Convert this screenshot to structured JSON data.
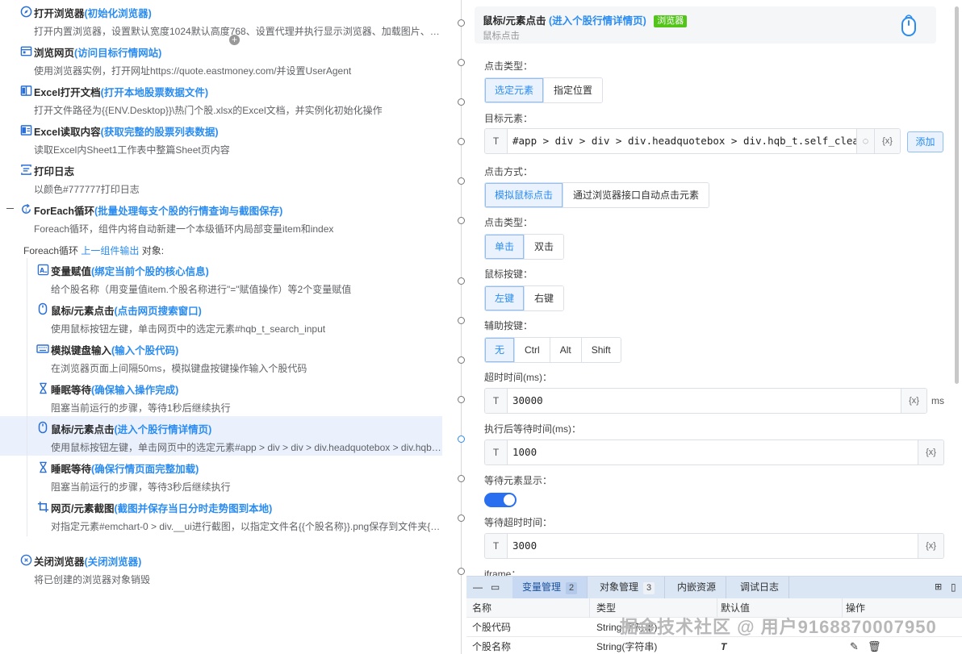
{
  "workflow": {
    "steps": [
      {
        "title": "打开浏览器",
        "note": "(初始化浏览器)",
        "desc": "打开内置浏览器，设置默认宽度1024默认高度768、设置代理并执行显示浏览器、加载图片、…",
        "icon": "compass-icon"
      },
      {
        "title": "浏览网页",
        "note": "(访问目标行情网站)",
        "desc": "使用浏览器实例，打开网址https://quote.eastmoney.com/并设置UserAgent",
        "icon": "browser-window-icon"
      },
      {
        "title": "Excel打开文档",
        "note": "(打开本地股票数据文件)",
        "desc": "打开文件路径为{{ENV.Desktop}}\\热门个股.xlsx的Excel文档，并实例化初始化操作",
        "icon": "excel-book-icon"
      },
      {
        "title": "Excel读取内容",
        "note": "(获取完整的股票列表数据)",
        "desc": "读取Excel内Sheet1工作表中整篇Sheet页内容",
        "icon": "excel-read-icon"
      },
      {
        "title": "打印日志",
        "note": "",
        "desc": "以颜色#777777打印日志",
        "icon": "print-log-icon"
      },
      {
        "title": "ForEach循环",
        "note": "(批量处理每支个股的行情查询与截图保存)",
        "desc": "Foreach循环，组件内将自动新建一个本级循环内局部变量item和index",
        "icon": "loop-icon"
      }
    ],
    "foreach_label": {
      "prefix": "Foreach循环",
      "link": "上一组件输出",
      "suffix": "对象:"
    },
    "children": [
      {
        "title": "变量赋值",
        "note": "(绑定当前个股的核心信息)",
        "desc": "给个股名称（用变量值item.个股名称进行\"=\"赋值操作）等2个变量赋值",
        "icon": "variable-assign-icon"
      },
      {
        "title": "鼠标/元素点击",
        "note": "(点击网页搜索窗口)",
        "desc": "使用鼠标按钮左键，单击网页中的选定元素#hqb_t_search_input",
        "icon": "mouse-icon"
      },
      {
        "title": "模拟键盘输入",
        "note": "(输入个股代码)",
        "desc": "在浏览器页面上间隔50ms，模拟键盘按键操作输入个股代码",
        "icon": "keyboard-icon"
      },
      {
        "title": "睡眠等待",
        "note": "(确保输入操作完成)",
        "desc": "阻塞当前运行的步骤，等待1秒后继续执行",
        "icon": "hourglass-icon"
      },
      {
        "title": "鼠标/元素点击",
        "note": "(进入个股行情详情页)",
        "desc": "使用鼠标按钮左键，单击网页中的选定元素#app > div > div > div.headquotebox > div.hqb…",
        "icon": "mouse-icon"
      },
      {
        "title": "睡眠等待",
        "note": "(确保行情页面完整加载)",
        "desc": "阻塞当前运行的步骤，等待3秒后继续执行",
        "icon": "hourglass-icon"
      },
      {
        "title": "网页/元素截图",
        "note": "(截图并保存当日分时走势图到本地)",
        "desc": "对指定元素#emchart-0 > div.__ui进行截图，以指定文件名{{个股名称}}.png保存到文件夹{{…",
        "icon": "crop-icon"
      }
    ],
    "final_step": {
      "title": "关闭浏览器",
      "note": "(关闭浏览器)",
      "desc": "将已创建的浏览器对象销毁",
      "icon": "close-browser-icon"
    }
  },
  "properties": {
    "header": {
      "title": "鼠标/元素点击",
      "note": "(进入个股行情详情页)",
      "badge": "浏览器",
      "subtitle": "鼠标点击",
      "badge_color": "#52c41a"
    },
    "click_type_label": "点击类型：",
    "click_type_options": [
      "选定元素",
      "指定位置"
    ],
    "target_label": "目标元素：",
    "target_tag": "T",
    "target_value": "#app > div > div > div.headquotebox > div.hqb_t.self_clear",
    "target_var": "{x}",
    "add_label": "添加",
    "method_label": "点击方式：",
    "method_options": [
      "模拟鼠标点击",
      "通过浏览器接口自动点击元素"
    ],
    "click_kind_label": "点击类型：",
    "click_kind_options": [
      "单击",
      "双击"
    ],
    "mouse_button_label": "鼠标按键：",
    "mouse_button_options": [
      "左键",
      "右键"
    ],
    "modifier_label": "辅助按键：",
    "modifier_options": [
      "无",
      "Ctrl",
      "Alt",
      "Shift"
    ],
    "timeout_label": "超时时间(ms)：",
    "timeout_tag": "T",
    "timeout_value": "30000",
    "timeout_var": "{x}",
    "timeout_unit": "ms",
    "after_wait_label": "执行后等待时间(ms)：",
    "after_wait_tag": "T",
    "after_wait_value": "1000",
    "after_wait_var": "{x}",
    "wait_visible_label": "等待元素显示：",
    "wait_visible_on": true,
    "wait_timeout_label": "等待超时时间：",
    "wait_timeout_tag": "T",
    "wait_timeout_value": "3000",
    "wait_timeout_var": "{x}",
    "iframe_label": "iframe："
  },
  "dock": {
    "tabs": [
      {
        "label": "变量管理",
        "count": "2"
      },
      {
        "label": "对象管理",
        "count": "3"
      },
      {
        "label": "内嵌资源",
        "count": ""
      },
      {
        "label": "调试日志",
        "count": ""
      }
    ],
    "columns": [
      "名称",
      "类型",
      "默认值",
      "操作"
    ],
    "rows": [
      {
        "name": "个股代码",
        "type": "String(字符串)",
        "default": ""
      },
      {
        "name": "个股名称",
        "type": "String(字符串)",
        "default": "T"
      }
    ]
  },
  "watermark": "掘金技术社区 @ 用户9168870007950",
  "colors": {
    "accent": "#2a8cf0",
    "badge": "#52c41a",
    "toggle": "#2a6ff0"
  }
}
